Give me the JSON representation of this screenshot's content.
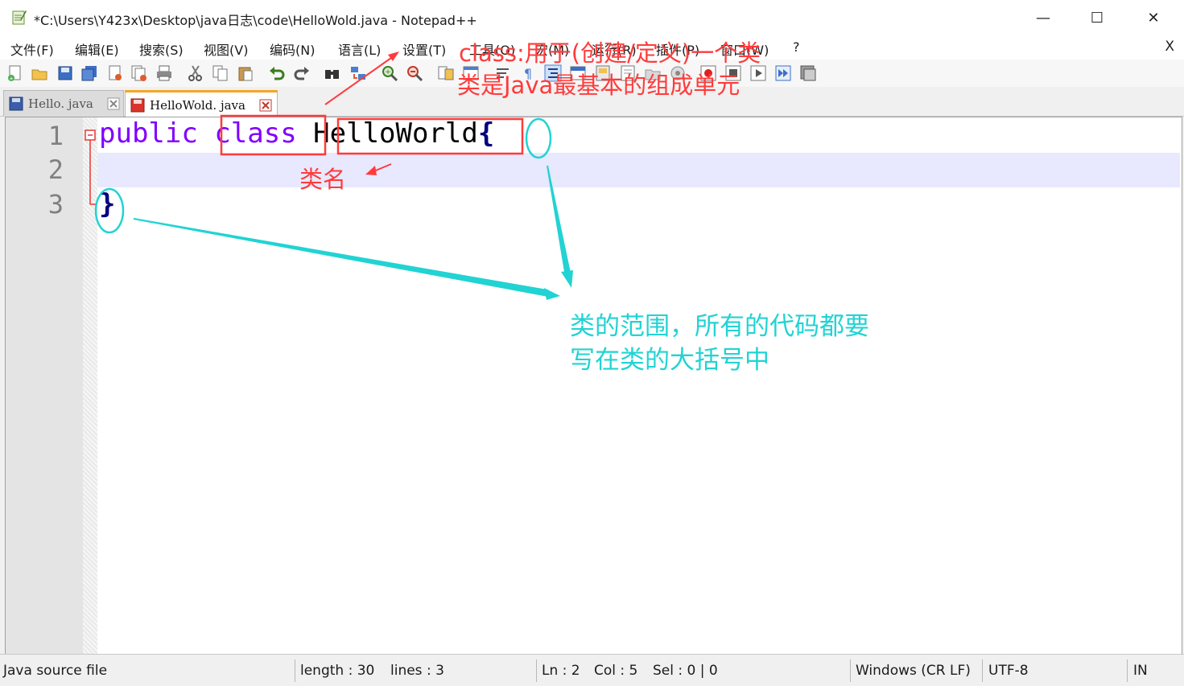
{
  "window": {
    "title": "*C:\\Users\\Y423x\\Desktop\\java日志\\code\\HelloWold.java - Notepad++",
    "minimize": "—",
    "maximize": "☐",
    "close": "✕"
  },
  "menu": {
    "items": [
      "文件(F)",
      "编辑(E)",
      "搜索(S)",
      "视图(V)",
      "编码(N)",
      "语言(L)",
      "设置(T)",
      "工具(O)",
      "宏(M)",
      "运行(R)",
      "插件(P)",
      "窗口(W)",
      "?"
    ],
    "close": "X"
  },
  "tabs": [
    {
      "label": "Hello. java",
      "active": false
    },
    {
      "label": "HelloWold. java",
      "active": true
    }
  ],
  "editor": {
    "line_numbers": [
      "1",
      "2",
      "3"
    ],
    "line1": {
      "kw1": "public",
      "kw2": "class",
      "name": "HelloWorld",
      "brace": "{"
    },
    "line3": {
      "brace": "}"
    },
    "current_line": 2
  },
  "annotations": {
    "class_desc_1": "class:用于(创建/定义)一个类",
    "class_desc_2": "类是Java最基本的组成单元",
    "class_name": "类名",
    "scope_1": "类的范围，所有的代码都要",
    "scope_2": "写在类的大括号中"
  },
  "status": {
    "file_type": "Java source file",
    "length": "length : 30",
    "lines": "lines : 3",
    "ln": "Ln : 2",
    "col": "Col : 5",
    "sel": "Sel : 0 | 0",
    "eol": "Windows (CR LF)",
    "encoding": "UTF-8",
    "mode": "IN"
  },
  "colors": {
    "keyword": "#8000ff",
    "brace": "#000080",
    "annotation_red": "#ff3b3b",
    "annotation_cyan": "#22d3d3",
    "tab_accent": "#f5a623",
    "current_line": "#e8e8ff"
  }
}
